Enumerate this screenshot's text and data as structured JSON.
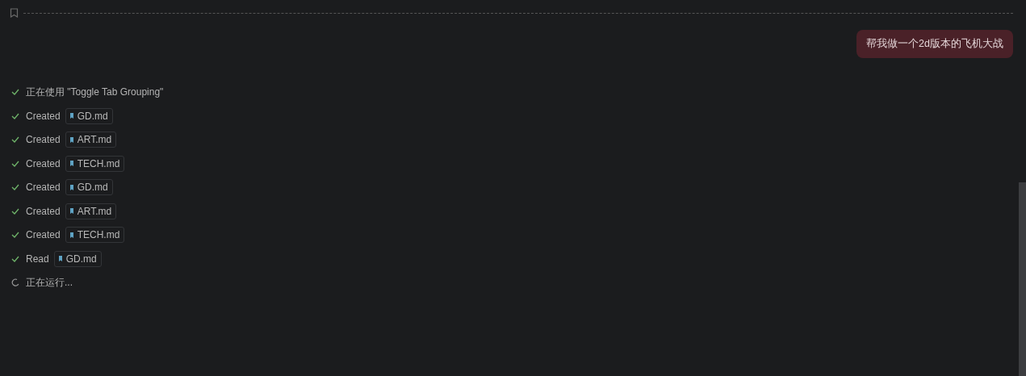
{
  "user_message": "帮我做一个2d版本的飞机大战",
  "steps": [
    {
      "kind": "done",
      "action": "正在使用 \"Toggle Tab Grouping\""
    },
    {
      "kind": "done",
      "action": "Created",
      "file": "GD.md"
    },
    {
      "kind": "done",
      "action": "Created",
      "file": "ART.md"
    },
    {
      "kind": "done",
      "action": "Created",
      "file": "TECH.md"
    },
    {
      "kind": "done",
      "action": "Created",
      "file": "GD.md"
    },
    {
      "kind": "done",
      "action": "Created",
      "file": "ART.md"
    },
    {
      "kind": "done",
      "action": "Created",
      "file": "TECH.md"
    },
    {
      "kind": "done",
      "action": "Read",
      "file": "GD.md"
    },
    {
      "kind": "running",
      "action": "正在运行..."
    }
  ]
}
